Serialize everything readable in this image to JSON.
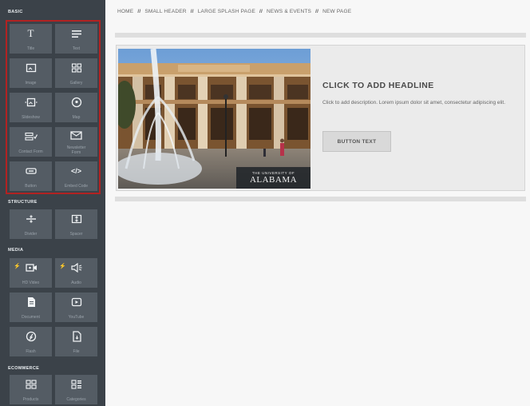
{
  "sidebar": {
    "sections": [
      {
        "label": "BASIC",
        "tiles": [
          {
            "label": "Title",
            "icon": "title-icon"
          },
          {
            "label": "Text",
            "icon": "text-icon"
          },
          {
            "label": "Image",
            "icon": "image-icon"
          },
          {
            "label": "Gallery",
            "icon": "gallery-icon"
          },
          {
            "label": "Slideshow",
            "icon": "slideshow-icon"
          },
          {
            "label": "Map",
            "icon": "map-icon"
          },
          {
            "label": "Contact Form",
            "icon": "contact-form-icon"
          },
          {
            "label": "Newsletter Form",
            "icon": "newsletter-icon"
          },
          {
            "label": "Button",
            "icon": "button-icon"
          },
          {
            "label": "Embed Code",
            "icon": "embed-code-icon"
          }
        ]
      },
      {
        "label": "STRUCTURE",
        "tiles": [
          {
            "label": "Divider",
            "icon": "divider-icon"
          },
          {
            "label": "Spacer",
            "icon": "spacer-icon"
          }
        ]
      },
      {
        "label": "MEDIA",
        "tiles": [
          {
            "label": "HD Video",
            "icon": "video-icon",
            "badge": "lightning-icon"
          },
          {
            "label": "Audio",
            "icon": "audio-icon",
            "badge": "lightning-icon"
          },
          {
            "label": "Document",
            "icon": "document-icon"
          },
          {
            "label": "YouTube",
            "icon": "youtube-icon"
          },
          {
            "label": "Flash",
            "icon": "flash-icon"
          },
          {
            "label": "File",
            "icon": "file-icon"
          }
        ]
      },
      {
        "label": "ECOMMERCE",
        "tiles": [
          {
            "label": "Products",
            "icon": "products-icon"
          },
          {
            "label": "Categories",
            "icon": "categories-icon"
          }
        ]
      }
    ]
  },
  "topnav": {
    "items": [
      "HOME",
      "SMALL HEADER",
      "LARGE SPLASH PAGE",
      "NEWS & EVENTS",
      "NEW PAGE"
    ],
    "separator": "//"
  },
  "hero": {
    "headline": "CLICK TO ADD HEADLINE",
    "description": "Click to add description. Lorem ipsum dolor sit amet, consectetur adipiscing elit.",
    "button_label": "BUTTON TEXT",
    "photo_caption_small": "THE UNIVERSITY OF",
    "photo_caption_large": "ALABAMA"
  },
  "colors": {
    "sidebar_bg": "#3b4249",
    "tile_bg": "#545c64",
    "highlight_border": "#b22222",
    "accent_flash": "#f4b324"
  }
}
